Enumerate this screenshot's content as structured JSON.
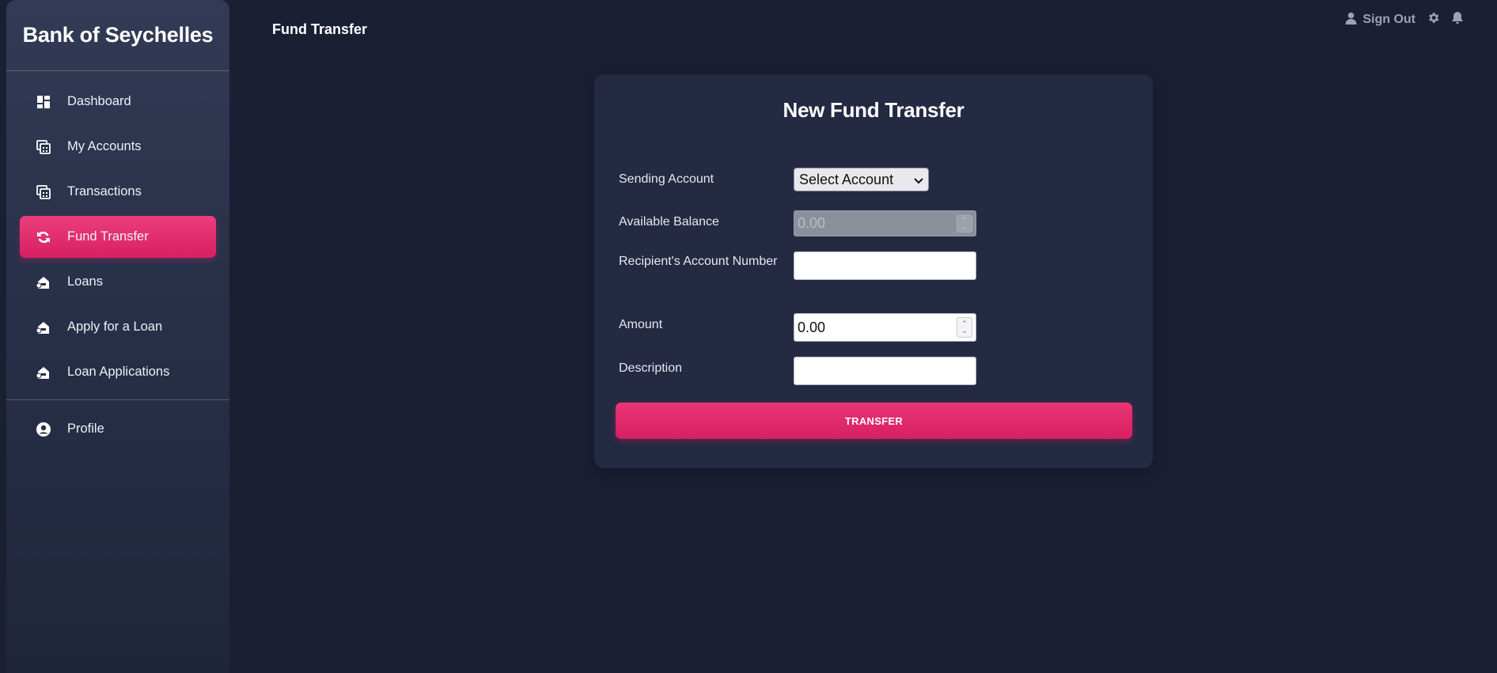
{
  "brand": "Bank of Seychelles",
  "page_title": "Fund Transfer",
  "sidebar": {
    "items": [
      {
        "label": "Dashboard",
        "icon": "dashboard-icon"
      },
      {
        "label": "My Accounts",
        "icon": "accounts-icon"
      },
      {
        "label": "Transactions",
        "icon": "transactions-icon"
      },
      {
        "label": "Fund Transfer",
        "icon": "transfer-icon",
        "active": true
      },
      {
        "label": "Loans",
        "icon": "loan-icon"
      },
      {
        "label": "Apply for a Loan",
        "icon": "loan-icon"
      },
      {
        "label": "Loan Applications",
        "icon": "loan-icon"
      }
    ],
    "profile": {
      "label": "Profile",
      "icon": "profile-icon"
    }
  },
  "topbar": {
    "signout_label": "Sign Out",
    "icons": [
      "user-icon",
      "gear-icon",
      "bell-icon"
    ]
  },
  "form": {
    "heading": "New Fund Transfer",
    "sending_account": {
      "label": "Sending Account",
      "selected": "Select Account"
    },
    "available_balance": {
      "label": "Available Balance",
      "value": "0.00"
    },
    "recipient": {
      "label": "Recipient's Account Number",
      "value": ""
    },
    "amount": {
      "label": "Amount",
      "value": "0.00"
    },
    "description": {
      "label": "Description",
      "value": ""
    },
    "submit_label": "TRANSFER"
  },
  "colors": {
    "background": "#1a1f33",
    "card": "#232a42",
    "accent": "#e0286b"
  }
}
